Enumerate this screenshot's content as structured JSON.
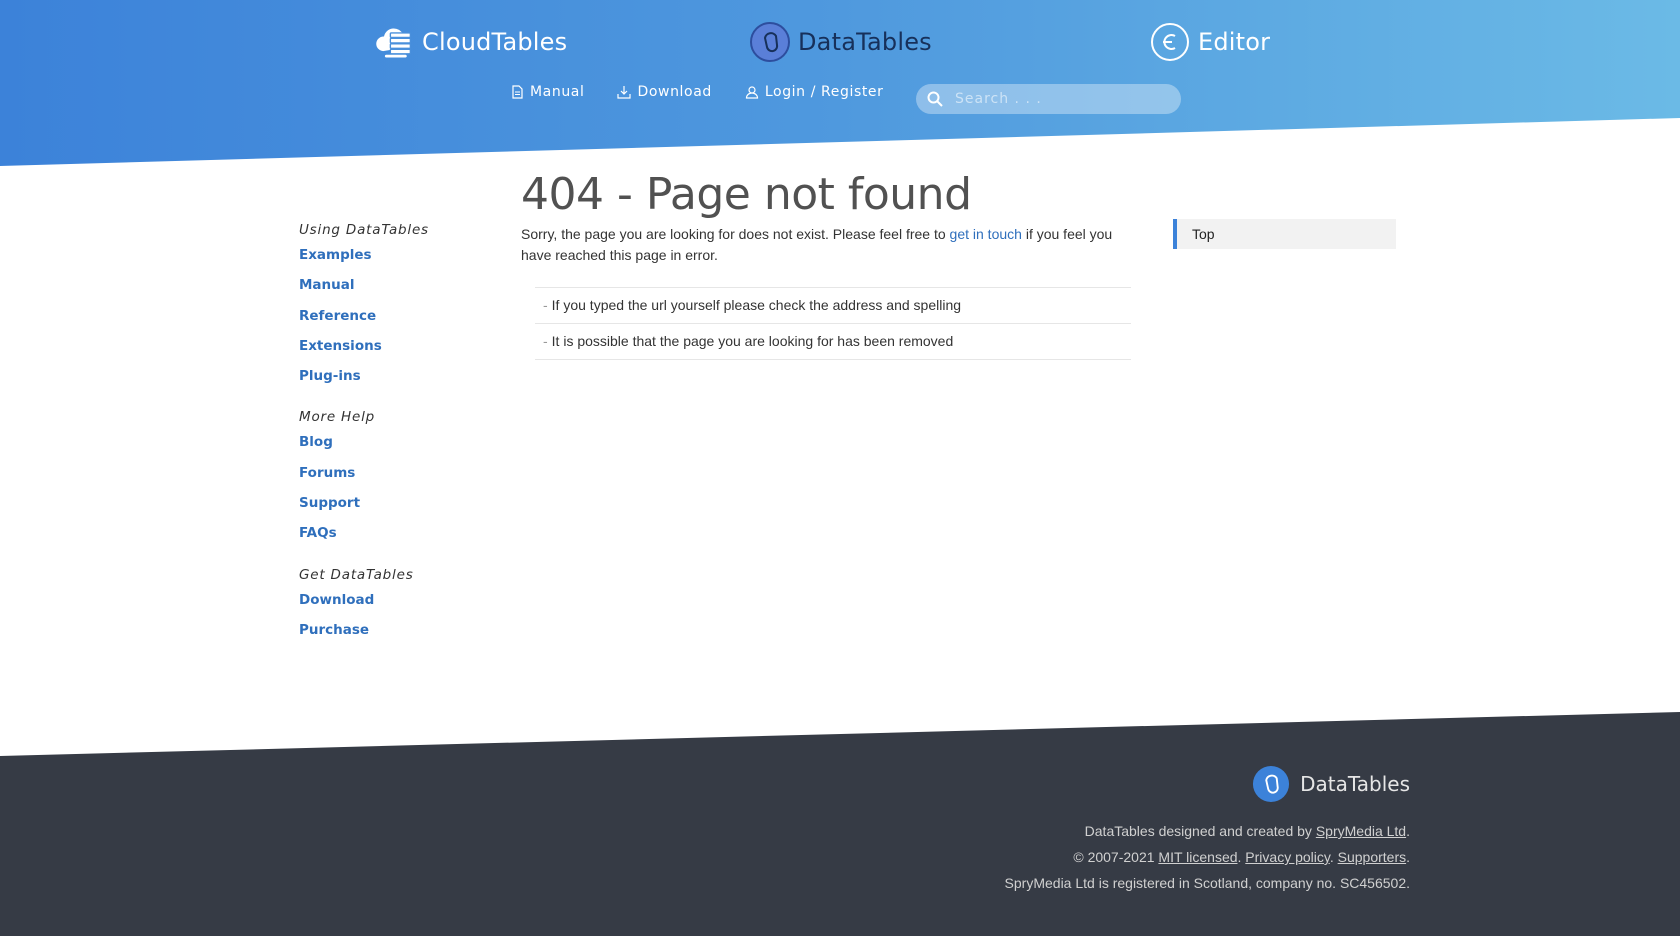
{
  "header": {
    "brands": [
      {
        "name": "CloudTables",
        "icon": "cloudtables-logo-icon"
      },
      {
        "name": "DataTables",
        "icon": "datatables-logo-icon"
      },
      {
        "name": "Editor",
        "icon": "editor-logo-icon"
      }
    ],
    "nav": [
      {
        "label": "Manual",
        "icon": "document-icon"
      },
      {
        "label": "Download",
        "icon": "download-icon"
      },
      {
        "label": "Login / Register",
        "icon": "user-icon"
      }
    ],
    "search": {
      "placeholder": "Search . . .",
      "value": "",
      "icon": "search-icon"
    }
  },
  "sidebar": {
    "groups": [
      {
        "heading": "Using DataTables",
        "links": [
          "Examples",
          "Manual",
          "Reference",
          "Extensions",
          "Plug-ins"
        ]
      },
      {
        "heading": "More Help",
        "links": [
          "Blog",
          "Forums",
          "Support",
          "FAQs"
        ]
      },
      {
        "heading": "Get DataTables",
        "links": [
          "Download",
          "Purchase"
        ]
      }
    ]
  },
  "main": {
    "title": "404 - Page not found",
    "lead_before": "Sorry, the page you are looking for does not exist. Please feel free to ",
    "lead_link": "get in touch",
    "lead_after": " if you feel you have reached this page in error.",
    "tips": [
      "If you typed the url yourself please check the address and spelling",
      "It is possible that the page you are looking for has been removed"
    ],
    "bullet": "-"
  },
  "toc": {
    "label": "Top"
  },
  "footer": {
    "brand": "DataTables",
    "line1_text": "DataTables designed and created by ",
    "line1_link": "SpryMedia Ltd",
    "line1_end": ".",
    "line2_prefix": "© 2007-2021 ",
    "line2_link1": "MIT licensed",
    "line2_sep1": ". ",
    "line2_link2": "Privacy policy",
    "line2_sep2": ". ",
    "line2_link3": "Supporters",
    "line2_end": ".",
    "line3": "SpryMedia Ltd is registered in Scotland, company no. SC456502."
  },
  "colors": {
    "header_gradient_start": "#3c82d9",
    "header_gradient_end": "#6bbae6",
    "link": "#2f6fbc",
    "footer_bg": "#363b45",
    "datatables_brand_text": "#17305a"
  }
}
